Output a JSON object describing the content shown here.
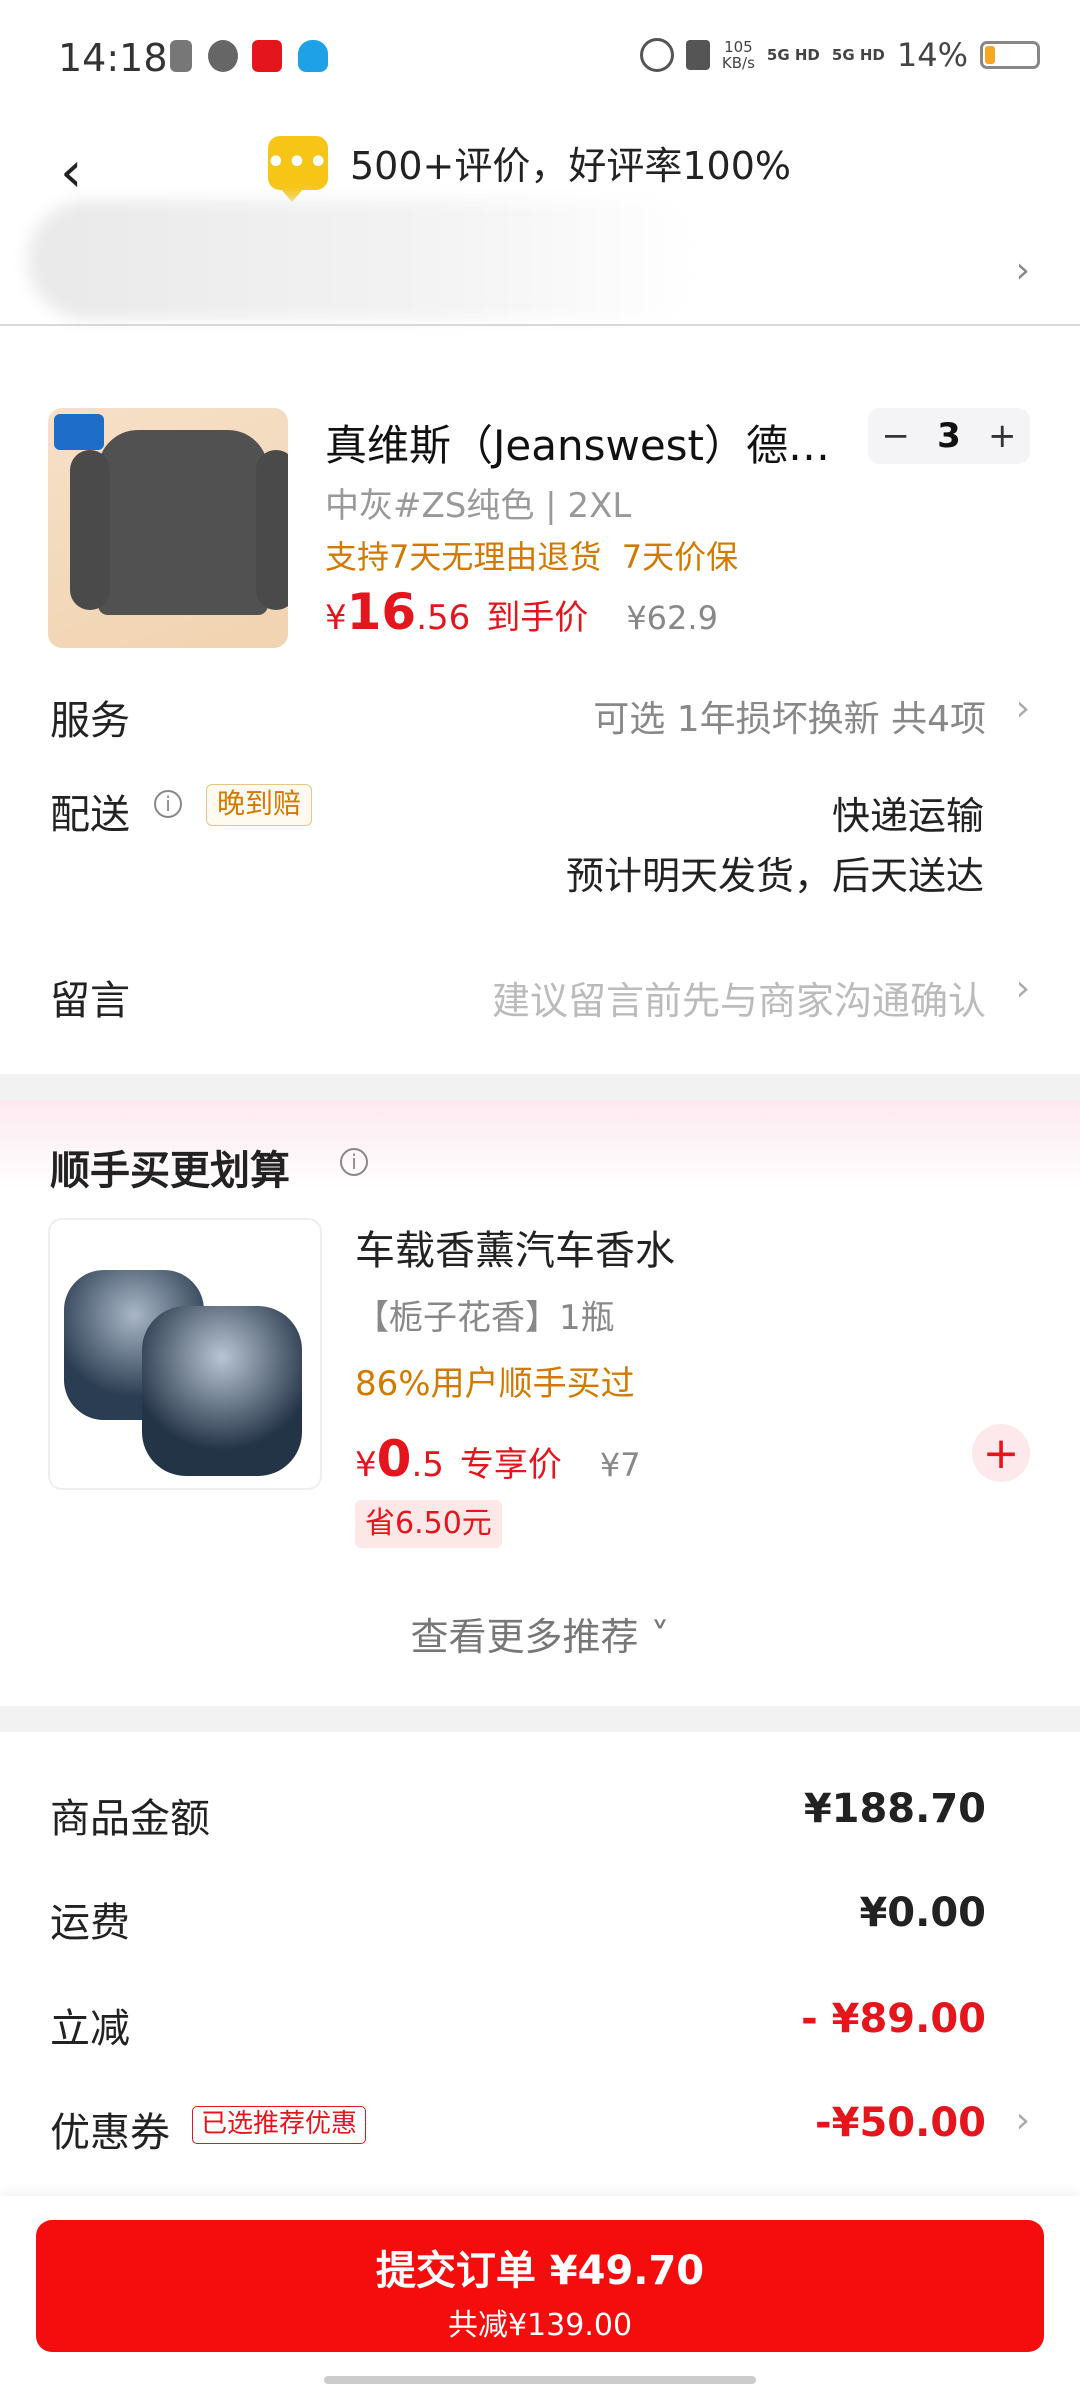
{
  "status_bar": {
    "time": "14:18",
    "net_speed": "105\nKB/s",
    "sim1": "5G HD",
    "sim2": "5G HD",
    "battery": "14%"
  },
  "header": {
    "review_text": "500+评价，好评率100%",
    "back_icon": "back-arrow-icon"
  },
  "product": {
    "title": "真维斯（Jeanswest）德…",
    "spec": "中灰#ZS纯色 | 2XL",
    "return_policy": "支持7天无理由退货  7天价保",
    "price_symbol": "¥",
    "price_int": "16",
    "price_dec": ".56",
    "price_tag": "到手价",
    "original_price": "¥62.9",
    "quantity": "3",
    "minus": "−",
    "plus": "+"
  },
  "service": {
    "label": "服务",
    "value": "可选 1年损坏换新 共4项"
  },
  "delivery": {
    "label": "配送",
    "badge": "晚到赔",
    "method": "快递运输",
    "estimate": "预计明天发货，后天送达"
  },
  "message": {
    "label": "留言",
    "placeholder": "建议留言前先与商家沟通确认"
  },
  "recommend": {
    "title": "顺手买更划算",
    "item": {
      "name": "车载香薰汽车香水",
      "spec": "【栀子花香】1瓶",
      "bought": "86%用户顺手买过",
      "price_symbol": "¥",
      "price_int": "0",
      "price_dec": ".5",
      "price_tag": "专享价",
      "original_price": "¥7",
      "save": "省6.50元"
    },
    "more": "查看更多推荐 ˅"
  },
  "summary": {
    "goods_label": "商品金额",
    "goods_value": "¥188.70",
    "shipping_label": "运费",
    "shipping_value": "¥0.00",
    "discount_label": "立减",
    "discount_value": "- ¥89.00",
    "coupon_label": "优惠券",
    "coupon_badge": "已选推荐优惠",
    "coupon_value": "-¥50.00"
  },
  "submit": {
    "main": "提交订单 ¥49.70",
    "sub": "共减¥139.00"
  },
  "colors": {
    "accent": "#f50d0d",
    "orange": "#d27a00",
    "price": "#e4151c"
  }
}
